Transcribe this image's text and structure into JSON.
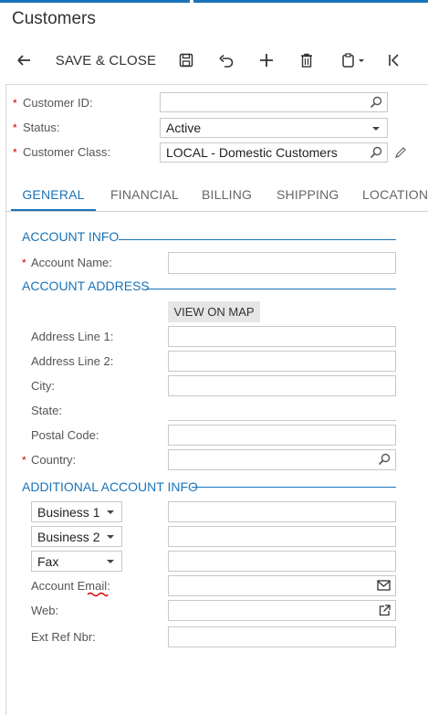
{
  "page": {
    "title": "Customers"
  },
  "toolbar": {
    "back_icon": "arrow-left-icon",
    "save_close_label": "SAVE & CLOSE",
    "save_icon": "floppy-icon",
    "undo_icon": "undo-icon",
    "add_icon": "plus-icon",
    "delete_icon": "trash-icon",
    "copy_icon": "clipboard-icon",
    "first_icon": "first-record-icon"
  },
  "header": {
    "customer_id_label": "Customer ID:",
    "customer_id_value": "",
    "status_label": "Status:",
    "status_value": "Active",
    "customer_class_label": "Customer Class:",
    "customer_class_value": "LOCAL - Domestic Customers"
  },
  "tabs": [
    {
      "label": "GENERAL"
    },
    {
      "label": "FINANCIAL"
    },
    {
      "label": "BILLING"
    },
    {
      "label": "SHIPPING"
    },
    {
      "label": "LOCATIONS"
    }
  ],
  "account_info": {
    "title": "ACCOUNT INFO",
    "account_name_label": "Account Name:",
    "account_name_value": ""
  },
  "account_address": {
    "title": "ACCOUNT ADDRESS",
    "view_on_map": "VIEW ON MAP",
    "address_line1_label": "Address Line 1:",
    "address_line2_label": "Address Line 2:",
    "city_label": "City:",
    "state_label": "State:",
    "postal_code_label": "Postal Code:",
    "country_label": "Country:"
  },
  "additional": {
    "title": "ADDITIONAL ACCOUNT INFO",
    "phone1_type": "Business 1",
    "phone2_type": "Business 2",
    "phone3_type": "Fax",
    "email_label": "Account Email:",
    "web_label": "Web:",
    "ext_ref_label": "Ext Ref Nbr:"
  },
  "colors": {
    "accent": "#1a73b8",
    "required": "#cc0000",
    "annotation": "#dd0000"
  }
}
